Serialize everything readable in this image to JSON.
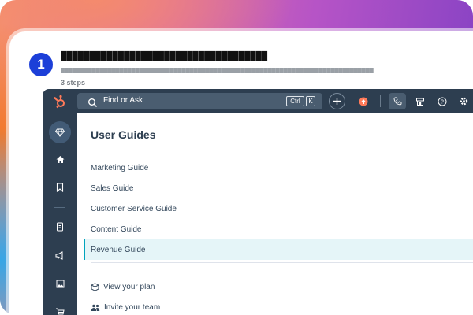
{
  "step": {
    "number": "1",
    "title": "████████████████████████████████████",
    "description": "████████████████████████████████████████████████████████████████████████████████",
    "count": "3 steps"
  },
  "topbar": {
    "search_placeholder": "Find or Ask",
    "shortcut_ctrl": "Ctrl",
    "shortcut_key": "K"
  },
  "guides": {
    "title": "User Guides",
    "items": [
      {
        "label": "Marketing Guide"
      },
      {
        "label": "Sales Guide"
      },
      {
        "label": "Customer Service Guide"
      },
      {
        "label": "Content Guide"
      },
      {
        "label": "Revenue Guide",
        "active": true
      }
    ]
  },
  "actions": {
    "view_plan": "View your plan",
    "invite_team": "Invite your team"
  },
  "colors": {
    "nav_bg": "#2d3e50",
    "accent_orange": "#ff7a59",
    "step_blue": "#1c3fd8",
    "active_bg": "#e5f5f8",
    "active_border": "#00a4bd"
  },
  "icons": [
    "hubspot-logo-icon",
    "search-icon",
    "plus-icon",
    "upgrade-icon",
    "phone-icon",
    "marketplace-icon",
    "help-icon",
    "settings-icon",
    "diamond-icon",
    "home-icon",
    "bookmark-icon",
    "contacts-icon",
    "megaphone-icon",
    "image-icon",
    "cart-icon",
    "cube-icon",
    "team-icon"
  ]
}
